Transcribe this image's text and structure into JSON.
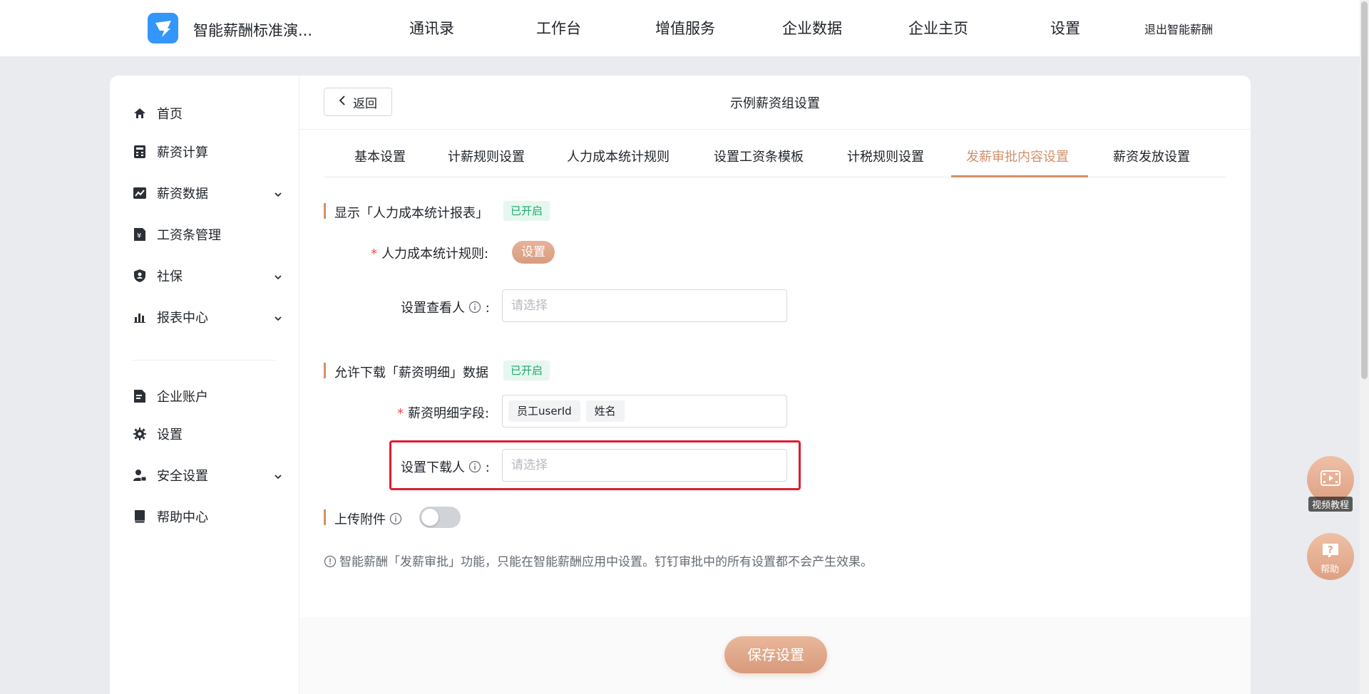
{
  "header": {
    "app_title": "智能薪酬标准演...",
    "nav": [
      "通讯录",
      "工作台",
      "增值服务",
      "企业数据",
      "企业主页",
      "设置"
    ],
    "logout": "退出智能薪酬"
  },
  "sidebar": {
    "items": [
      {
        "label": "首页",
        "icon": "home-icon"
      },
      {
        "label": "薪资计算",
        "icon": "calculator-icon"
      },
      {
        "label": "薪资数据",
        "icon": "chart-icon"
      },
      {
        "label": "工资条管理",
        "icon": "payslip-icon"
      },
      {
        "label": "社保",
        "icon": "shield-icon"
      },
      {
        "label": "报表中心",
        "icon": "bar-chart-icon"
      },
      {
        "label": "企业账户",
        "icon": "account-icon"
      },
      {
        "label": "设置",
        "icon": "gear-icon"
      },
      {
        "label": "安全设置",
        "icon": "user-lock-icon"
      },
      {
        "label": "帮助中心",
        "icon": "book-icon"
      }
    ]
  },
  "content": {
    "back_label": "返回",
    "title": "示例薪资组设置",
    "tabs": [
      "基本设置",
      "计薪规则设置",
      "人力成本统计规则",
      "设置工资条模板",
      "计税规则设置",
      "发薪审批内容设置",
      "薪资发放设置"
    ],
    "active_tab": "发薪审批内容设置"
  },
  "section1": {
    "title": "显示「人力成本统计报表」",
    "badge": "已开启",
    "rule_label": "人力成本统计规则:",
    "rule_button": "设置",
    "viewer_label": "设置查看人",
    "viewer_placeholder": "请选择"
  },
  "section2": {
    "title": "允许下载「薪资明细」数据",
    "badge": "已开启",
    "fields_label": "薪资明细字段:",
    "fields": [
      "员工userId",
      "姓名"
    ],
    "downloader_label": "设置下载人",
    "downloader_placeholder": "请选择"
  },
  "section3": {
    "title": "上传附件",
    "toggle_on": false
  },
  "notice": "智能薪酬「发薪审批」功能，只能在智能薪酬应用中设置。钉钉审批中的所有设置都不会产生效果。",
  "save_label": "保存设置",
  "floating": {
    "video_label": "视频教程",
    "help_label": "帮助"
  },
  "colors": {
    "accent": "#d2906a",
    "badge_bg": "#e6f7ef",
    "badge_text": "#1aa96d",
    "highlight": "#e01c2f",
    "logo": "#3296fa"
  }
}
